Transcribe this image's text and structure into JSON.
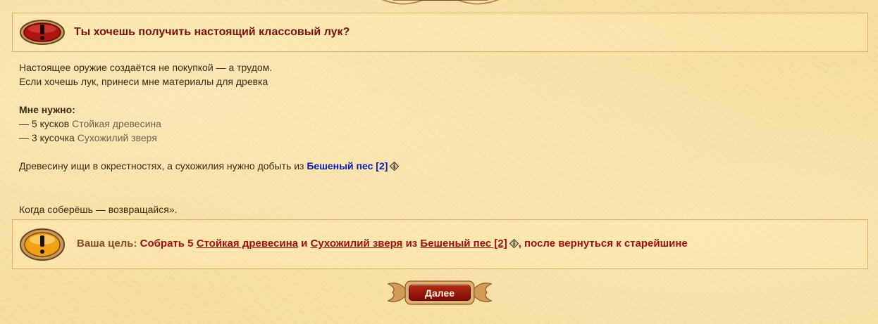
{
  "dialog": {
    "title": "Ты хочешь получить настоящий классовый лук?",
    "lines": [
      "Настоящее оружие создаётся не покупкой — а трудом.",
      "Если хочешь лук, принеси мне материалы для древка"
    ],
    "need_label": "Мне нужно:",
    "requirements": [
      {
        "prefix": "— 5 кусков ",
        "item": "Стойкая древесина"
      },
      {
        "prefix": "— 3 кусочка ",
        "item": "Сухожилий зверя"
      }
    ],
    "hint_prefix": "Древесину ищи в окрестностях, а сухожилия нужно добыть из ",
    "hint_npc": "Бешеный пес [2]",
    "closing": "Когда соберёшь — возвращайся»."
  },
  "goal": {
    "label": "Ваша цель:",
    "part1": "Собрать 5",
    "item1": "Стойкая древесина",
    "and": "и",
    "item2": "Сухожилий зверя",
    "from": "из",
    "npc": "Бешеный пес [2]",
    "part2": ", после вернуться к старейшине"
  },
  "buttons": {
    "next_label": "Далее"
  },
  "icons": {
    "title_badge": "exclamation-red-icon",
    "goal_badge": "exclamation-orange-icon",
    "info": "info-icon"
  },
  "colors": {
    "title": "#7a1010",
    "goal": "#a01010",
    "link_npc": "#0a1ab8",
    "item": "#706048"
  }
}
